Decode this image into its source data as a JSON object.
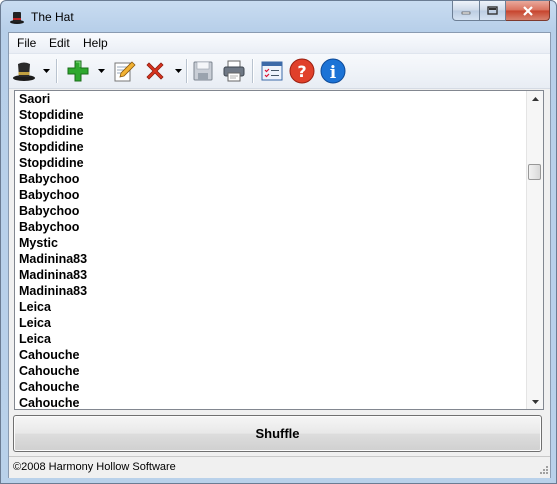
{
  "window": {
    "title": "The Hat",
    "app_icon": "top-hat-icon",
    "buttons": [
      "minimize-icon",
      "maximize-icon",
      "close-icon"
    ]
  },
  "menu": {
    "items": [
      {
        "label": "File"
      },
      {
        "label": "Edit"
      },
      {
        "label": "Help"
      }
    ]
  },
  "toolbar": {
    "buttons": [
      {
        "icon": "hat-icon",
        "dropdown": true
      },
      {
        "icon": "add-icon",
        "dropdown": true
      },
      {
        "icon": "edit-icon",
        "dropdown": false
      },
      {
        "icon": "delete-icon",
        "dropdown": true
      },
      {
        "icon": "save-icon",
        "dropdown": false
      },
      {
        "icon": "print-icon",
        "dropdown": false
      },
      {
        "icon": "checklist-icon",
        "dropdown": false
      },
      {
        "icon": "help-icon",
        "dropdown": false
      },
      {
        "icon": "info-icon",
        "dropdown": false
      }
    ],
    "colors": {
      "add": "#2ea82e",
      "delete": "#d9341f",
      "help": "#e0402a",
      "info": "#1c73d6"
    }
  },
  "list": {
    "items": [
      "Saori",
      "Stopdidine",
      "Stopdidine",
      "Stopdidine",
      "Stopdidine",
      "Babychoo",
      "Babychoo",
      "Babychoo",
      "Babychoo",
      "Mystic",
      "Madinina83",
      "Madinina83",
      "Madinina83",
      "Leica",
      "Leica",
      "Leica",
      "Cahouche",
      "Cahouche",
      "Cahouche",
      "Cahouche"
    ],
    "scroll_position": 0.3
  },
  "shuffle_button": {
    "label": "Shuffle"
  },
  "status": {
    "text": "©2008 Harmony Hollow Software"
  }
}
